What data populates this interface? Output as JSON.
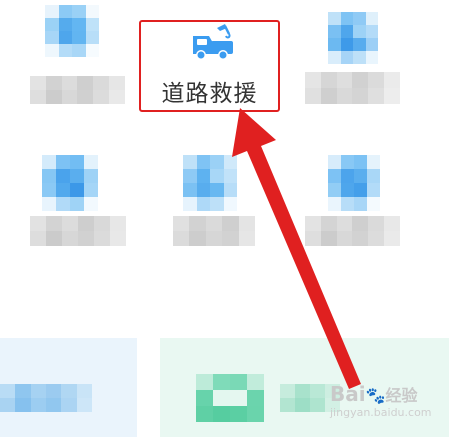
{
  "rescue": {
    "label": "道路救援",
    "icon": "tow-truck-icon",
    "accent": "#3b9cf0",
    "border_color": "#e02020"
  },
  "annotation": {
    "arrow_color": "#e02020"
  },
  "watermark": {
    "brand": "Bai",
    "brand_cn": "经验",
    "url": "jingyan.baidu.com"
  },
  "colors": {
    "mosaic_blue": "#63b6f2",
    "mosaic_gray": "#d9d9d9",
    "banner_blue_bg": "#eaf4fc",
    "banner_green_bg": "#e9f8f2",
    "mosaic_green": "#5fd3a8"
  }
}
